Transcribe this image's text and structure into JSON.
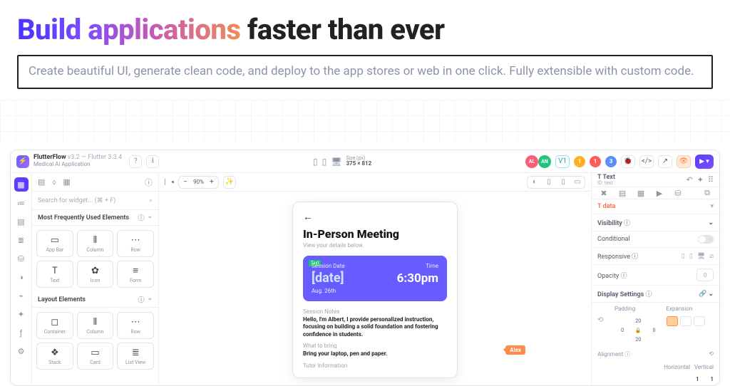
{
  "hero": {
    "h_grad": "Build applications",
    "h_rest": " faster than ever",
    "sub": "Create beautiful UI, generate clean code, and deploy to the app stores or web in one click. Fully extensible with custom code."
  },
  "meta": {
    "name": "FlutterFlow",
    "ver": "v3.2 — Flutter 3.3.4",
    "proj": "Medical Ai Application"
  },
  "size": {
    "lbl": "Size (px)",
    "val": "375 × 812"
  },
  "avatars": [
    {
      "t": "AL",
      "c": "#ff5b77"
    },
    {
      "t": "AN",
      "c": "#22c27a"
    }
  ],
  "vbadge": "V1",
  "badges": [
    {
      "t": "1",
      "c": "#ffb020"
    },
    {
      "t": "1",
      "c": "#ff5b5b"
    },
    {
      "t": "3",
      "c": "#5b8dff"
    }
  ],
  "search_ph": "Search for widget... (⌘ + F)",
  "sect1": "Most Frequently Used Elements",
  "sect2": "Layout Elements",
  "cells1": [
    {
      "ic": "▭",
      "lb": "App Bar"
    },
    {
      "ic": "⦀",
      "lb": "Column"
    },
    {
      "ic": "⋯",
      "lb": "Row"
    },
    {
      "ic": "T",
      "lb": "Text"
    },
    {
      "ic": "✿",
      "lb": "Icon"
    },
    {
      "ic": "≡",
      "lb": "Form"
    }
  ],
  "cells2": [
    {
      "ic": "◻",
      "lb": "Container"
    },
    {
      "ic": "⦀",
      "lb": "Column"
    },
    {
      "ic": "⋯",
      "lb": "Row"
    },
    {
      "ic": "❖",
      "lb": "Stack"
    },
    {
      "ic": "▭",
      "lb": "Card"
    },
    {
      "ic": "≣",
      "lb": "List View"
    }
  ],
  "zoom": "90%",
  "mock": {
    "title": "In-Person Meeting",
    "sub": "View your details below.",
    "tag": "Text",
    "sess_lbl": "Session Date",
    "time_lbl": "Time",
    "date": "[date]",
    "time": "6:30pm",
    "foot": "Aug. 26th",
    "sn_h": "Session Notes",
    "sn_b": "Hello, I'm Albert, I provide personalized instruction, focusing on building a solid foundation and fostering confidence in students.",
    "wb_h": "What to bring",
    "wb_b": "Bring your laptop, pen and paper.",
    "ti_h": "Tutor Information"
  },
  "cursor": "Alex",
  "rtop": {
    "a": "T Text",
    "b": "ID: text"
  },
  "rprop": "data",
  "vis": {
    "lbl": "Visibility",
    "cond": "Conditional",
    "resp": "Responsive",
    "op": "Opacity",
    "opval": "0"
  },
  "disp": {
    "lbl": "Display Settings",
    "pad": "Padding",
    "exp": "Expansion",
    "v": "20",
    "h": "0",
    "align": "Alignment",
    "hor": "Horizontal",
    "ver": "Vertical",
    "one": "1"
  }
}
